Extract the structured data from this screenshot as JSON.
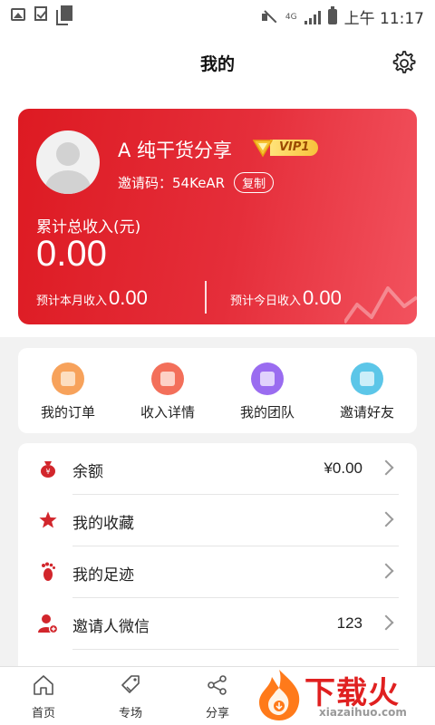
{
  "status_bar": {
    "time": "上午 11:17",
    "network": "4G",
    "icons": [
      "image-icon",
      "checkbox-icon",
      "document-icon",
      "mute-icon",
      "signal-icon",
      "battery-icon"
    ]
  },
  "header": {
    "title": "我的",
    "settings_icon": "gear-icon"
  },
  "profile": {
    "username": "A 纯干货分享",
    "vip_label": "VIP1",
    "invite_label": "邀请码：",
    "invite_code": "54KeAR",
    "copy_label": "复制",
    "total_income_label": "累计总收入(元)",
    "total_income_value": "0.00",
    "month_label": "预计本月收入",
    "month_value": "0.00",
    "today_label": "预计今日收入",
    "today_value": "0.00",
    "card_color_start": "#dd1a22",
    "card_color_end": "#f2525e"
  },
  "shortcuts": [
    {
      "label": "我的订单",
      "icon": "order-icon",
      "color": "#f7a25b"
    },
    {
      "label": "收入详情",
      "icon": "income-icon",
      "color": "#f36f5a"
    },
    {
      "label": "我的团队",
      "icon": "team-icon",
      "color": "#9a6cf0"
    },
    {
      "label": "邀请好友",
      "icon": "gift-icon",
      "color": "#5cc6e8"
    }
  ],
  "menu": [
    {
      "label": "余额",
      "value": "¥0.00",
      "icon": "money-bag-icon"
    },
    {
      "label": "我的收藏",
      "value": "",
      "icon": "star-icon"
    },
    {
      "label": "我的足迹",
      "value": "",
      "icon": "footprint-icon"
    },
    {
      "label": "邀请人微信",
      "value": "123",
      "icon": "user-add-icon"
    }
  ],
  "bottom_nav": [
    {
      "label": "首页",
      "icon": "home-icon"
    },
    {
      "label": "专场",
      "icon": "tag-icon"
    },
    {
      "label": "分享",
      "icon": "share-icon"
    }
  ],
  "watermark": {
    "brand": "下载火",
    "site": "xiazaihuo.com"
  },
  "colors": {
    "accent": "#e02a33",
    "menu_icon": "#d2262c"
  }
}
